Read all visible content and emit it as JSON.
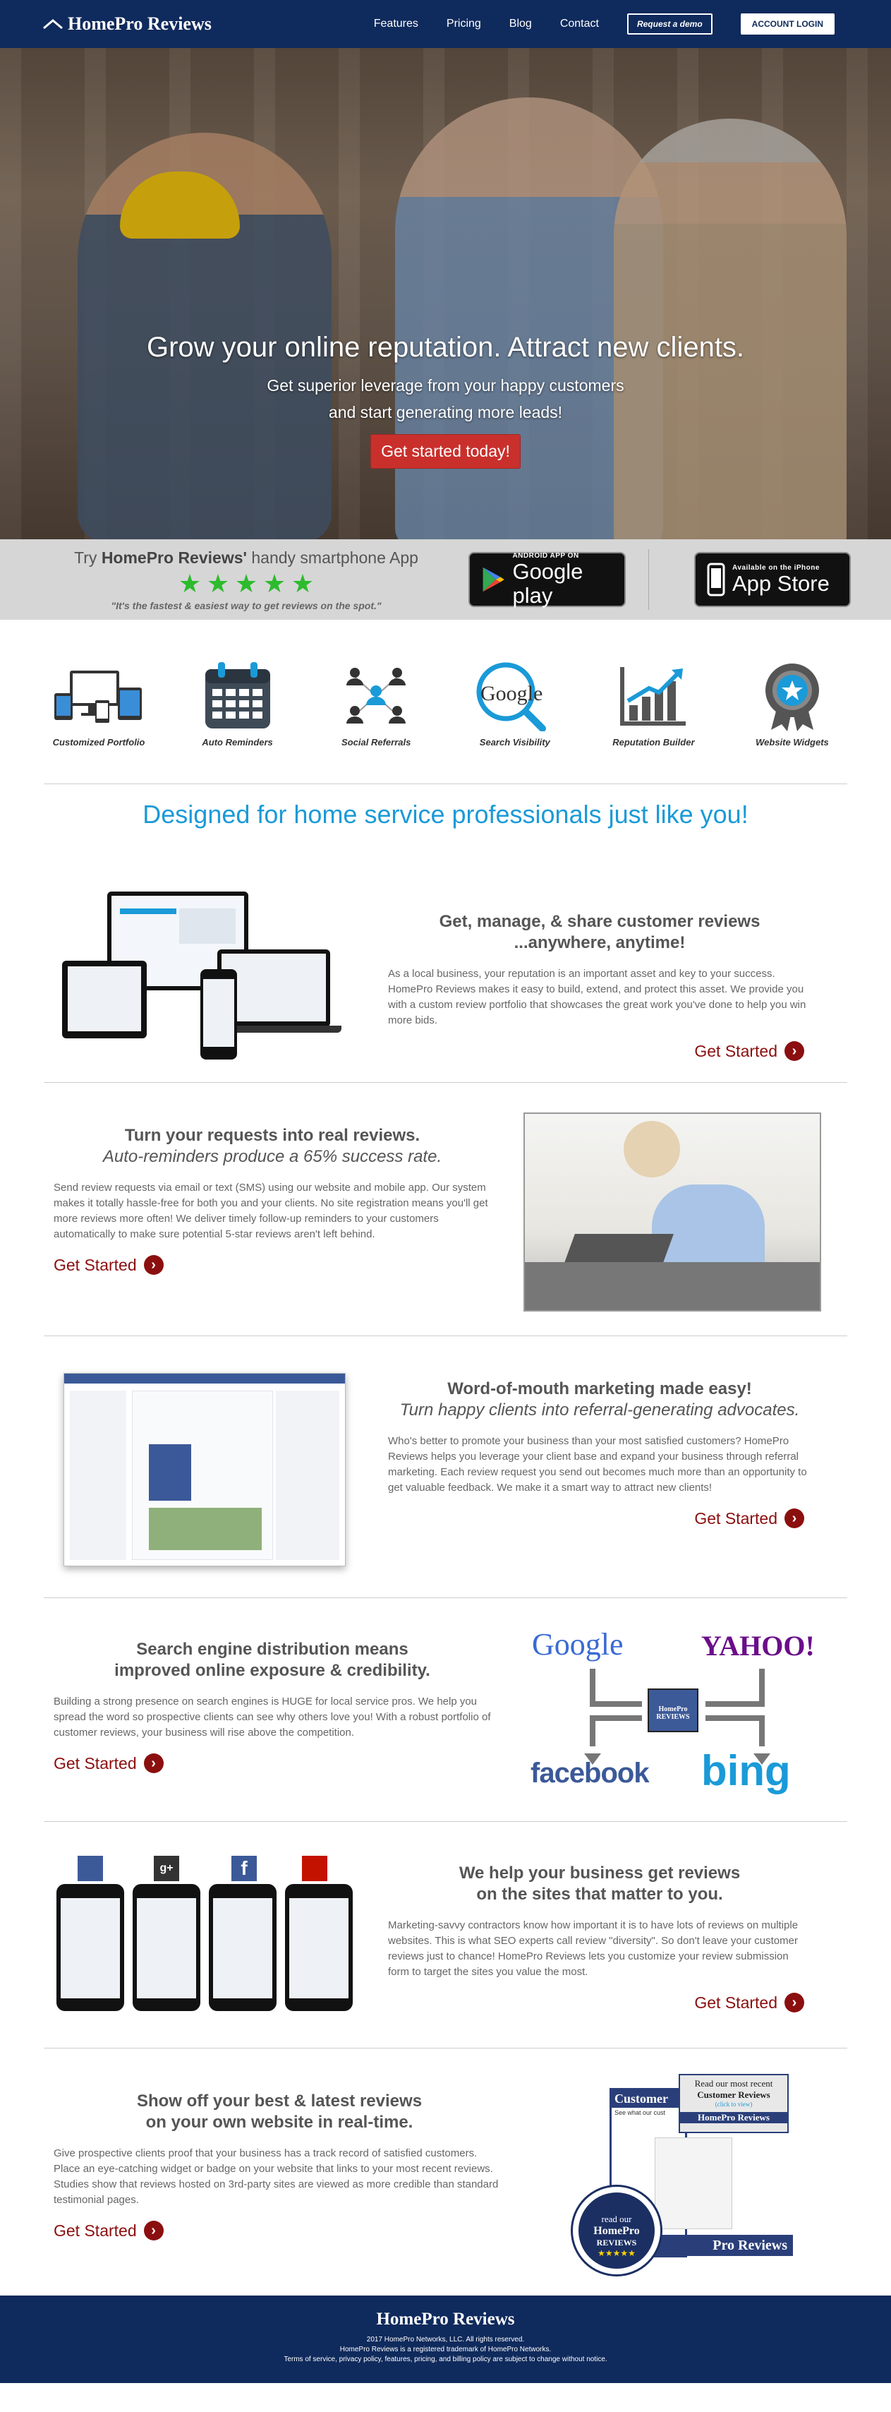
{
  "nav": {
    "logo": "HomePro Reviews",
    "links": [
      "Features",
      "Pricing",
      "Blog",
      "Contact"
    ],
    "demo": "Request a demo",
    "login": "ACCOUNT LOGIN"
  },
  "hero": {
    "title": "Grow your online reputation. Attract new clients.",
    "line1": "Get superior leverage from your happy customers",
    "line2": "and start generating more leads!",
    "cta": "Get started today!"
  },
  "appbar": {
    "try": "Try ",
    "brand": "HomePro Reviews'",
    "rest": " handy smartphone App",
    "rating": 5,
    "quote": "\"It's the fastest & easiest way to get reviews on the spot.\"",
    "google_small": "ANDROID APP ON",
    "google_big": "Google play",
    "apple_small": "Available on the iPhone",
    "apple_big": "App Store"
  },
  "features": [
    {
      "label": "Customized Portfolio",
      "icon": "devices-icon"
    },
    {
      "label": "Auto Reminders",
      "icon": "calendar-icon"
    },
    {
      "label": "Social Referrals",
      "icon": "network-icon"
    },
    {
      "label": "Search Visibility",
      "icon": "google-search-icon"
    },
    {
      "label": "Reputation Builder",
      "icon": "growth-chart-icon"
    },
    {
      "label": "Website Widgets",
      "icon": "badge-icon"
    }
  ],
  "tagline": "Designed for home service professionals just like you!",
  "sections": {
    "s1": {
      "title": "Get, manage, & share customer reviews",
      "title2": "...anywhere, anytime!",
      "body": "As a local business, your reputation is an important asset and key to your success. HomePro Reviews makes it easy to build, extend, and protect this asset. We provide you with a custom review portfolio that showcases the great work you've done to help you win more bids.",
      "cta": "Get Started"
    },
    "s2": {
      "title": "Turn your requests into real reviews.",
      "title2": "Auto-reminders produce a 65% success rate.",
      "body": "Send review requests via email or text (SMS) using our website and mobile app. Our system makes it totally hassle-free for both you and your clients. No site registration means you'll get more reviews more often! We deliver timely follow-up reminders to your customers automatically to make sure potential 5-star reviews aren't left behind.",
      "cta": "Get Started"
    },
    "s3": {
      "title": "Word-of-mouth marketing made easy!",
      "title2": "Turn happy clients into referral-generating advocates.",
      "body": "Who's better to promote your business than your most satisfied customers? HomePro Reviews helps you leverage your client base and expand your business through referral marketing. Each review request you send out becomes much more than an opportunity to get valuable feedback. We make it a smart way to attract new clients!",
      "cta": "Get Started"
    },
    "s4": {
      "title": "Search engine distribution means",
      "title2": "improved online exposure & credibility.",
      "body": "Building a strong presence on search engines is HUGE for local service pros. We help you spread the word so prospective clients can see why others love you! With a robust portfolio of customer reviews, your business will rise above the competition.",
      "cta": "Get Started",
      "logos": {
        "google": "Google",
        "yahoo": "YAHOO!",
        "facebook": "facebook",
        "bing": "bing",
        "center": "HomePro REVIEWS"
      }
    },
    "s5": {
      "title": "We help your business get reviews",
      "title2": "on the sites that matter to you.",
      "body": "Marketing-savvy contractors know how important it is to have lots of reviews on multiple websites. This is what SEO experts call review \"diversity\". So don't leave your customer reviews just to chance! HomePro Reviews lets you customize your review submission form to target the sites you value the most.",
      "cta": "Get Started"
    },
    "s6": {
      "title": "Show off your best & latest reviews",
      "title2": "on your own website in real-time.",
      "body": "Give prospective clients proof that your business has a track record of satisfied customers. Place an eye-catching widget or badge on your website that links to your most recent reviews. Studies show that reviews hosted on 3rd-party sites are viewed as more credible than standard testimonial pages.",
      "cta": "Get Started",
      "widget": {
        "head1": "Read our most recent",
        "head2": "Customer Reviews",
        "click": "(click to view)",
        "brand": "HomePro Reviews",
        "badge1": "read our",
        "badge2": "HomePro",
        "badge3": "REVIEWS",
        "side": "Customer",
        "side2": "See what our cust"
      }
    }
  },
  "footer": {
    "logo": "HomePro Reviews",
    "l1": "2017 HomePro Networks, LLC. All rights reserved.",
    "l2": "HomePro Reviews is a registered trademark of HomePro Networks.",
    "l3": "Terms of service, privacy policy, features, pricing, and billing policy are subject to change without notice."
  }
}
